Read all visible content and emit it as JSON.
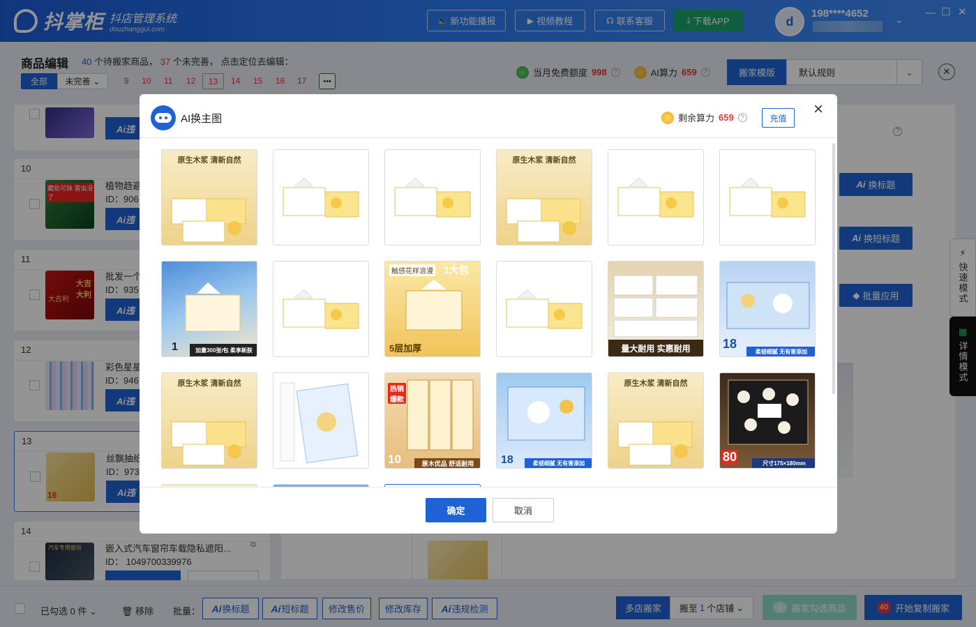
{
  "app": {
    "brand": "抖掌柜",
    "brand_sub": "抖店管理系统",
    "brand_url": "douzhanggui.com"
  },
  "topbar": {
    "buttons": [
      {
        "label": "新功能播报",
        "icon": "speaker-icon"
      },
      {
        "label": "视频教程",
        "icon": "video-icon"
      },
      {
        "label": "联系客服",
        "icon": "headset-icon"
      },
      {
        "label": "下载APP",
        "icon": "download-icon"
      }
    ],
    "user_phone": "198****4652"
  },
  "header": {
    "title": "商品编辑",
    "pending_count": "40",
    "pending_text": "个待搬家商品，",
    "incomplete_count": "37",
    "incomplete_text": "个未完善，  点击定位去编辑：",
    "filter_all": "全部",
    "filter_incomplete": "未完善",
    "pages": [
      "9",
      "10",
      "11",
      "12",
      "13",
      "14",
      "15",
      "16",
      "17"
    ],
    "current_page": "13",
    "more": "•••",
    "free_quota_label": "当月免费额度",
    "free_quota_value": "998",
    "ai_power_label": "AI算力",
    "ai_power_value": "659",
    "template_button": "搬家模版",
    "template_selected": "默认规则"
  },
  "products": [
    {
      "index": "10",
      "title": "植物趋避",
      "id": "ID：906"
    },
    {
      "index": "11",
      "title": "批发一个",
      "id": "ID：935"
    },
    {
      "index": "12",
      "title": "彩色星星",
      "id": "ID：946"
    },
    {
      "index": "13",
      "title": "丝飘抽纸",
      "id": "ID：973"
    },
    {
      "index": "14",
      "title": "嵌入式汽车窗帘车载隐私遮阳...",
      "id": "ID：  1049700339976"
    }
  ],
  "thumb_texts": {
    "t10": "藏处可抹 害虫没了",
    "t11a": "大吉大利",
    "t11b": "大吉利",
    "t13": "16",
    "t14": "汽车专用窗帘"
  },
  "product_btn_label": "Ai违",
  "right_buttons": {
    "title": "换标题",
    "short_title": "换短标题",
    "batch_apply": "批量应用",
    "ai_prefix": "Ai"
  },
  "side_tabs": {
    "quick": "快速模式",
    "detail": "详情模式"
  },
  "modal": {
    "title": "AI换主图",
    "remaining_label": "剩余算力",
    "remaining_value": "659",
    "recharge": "充值",
    "close": "×",
    "confirm": "确定",
    "cancel": "取消",
    "tile_texts": {
      "natural_caption": "原生木浆 清新自然",
      "touch_caption": "触感花样浪漫",
      "one_pack": "1大包",
      "five_layer": "5层加厚",
      "big_use": "量大耐用 实惠耐用",
      "count18": "18",
      "soft_text": "柔韧细腻 无有害添加",
      "hot": "热销爆款",
      "count10": "10",
      "quality_text": "原木优品 舒适耐用",
      "count80": "80",
      "size_text": "尺寸175×180mm",
      "one_label": "1",
      "add_text": "加量300张/包 柔享新肤"
    }
  },
  "bottombar": {
    "selected_text": "已勾选 0 件",
    "remove": "移除",
    "batch_label": "批量：",
    "batch_buttons": [
      {
        "label": "换标题",
        "ai": true
      },
      {
        "label": "短标题",
        "ai": true
      },
      {
        "label": "修改售价",
        "ai": false
      },
      {
        "label": "修改库存",
        "ai": false
      },
      {
        "label": "违规检测",
        "ai": true
      }
    ],
    "multi_store": "多店搬家",
    "move_to_prefix": "搬至",
    "move_to_count": "1",
    "move_to_suffix": "个店铺",
    "check_count": "0",
    "check_label": "搬家勾选商品",
    "start_count": "40",
    "start_label": "开始复制搬家"
  },
  "colors": {
    "primary": "#1e62d6",
    "danger": "#ee3333",
    "green": "#1aa36b"
  }
}
